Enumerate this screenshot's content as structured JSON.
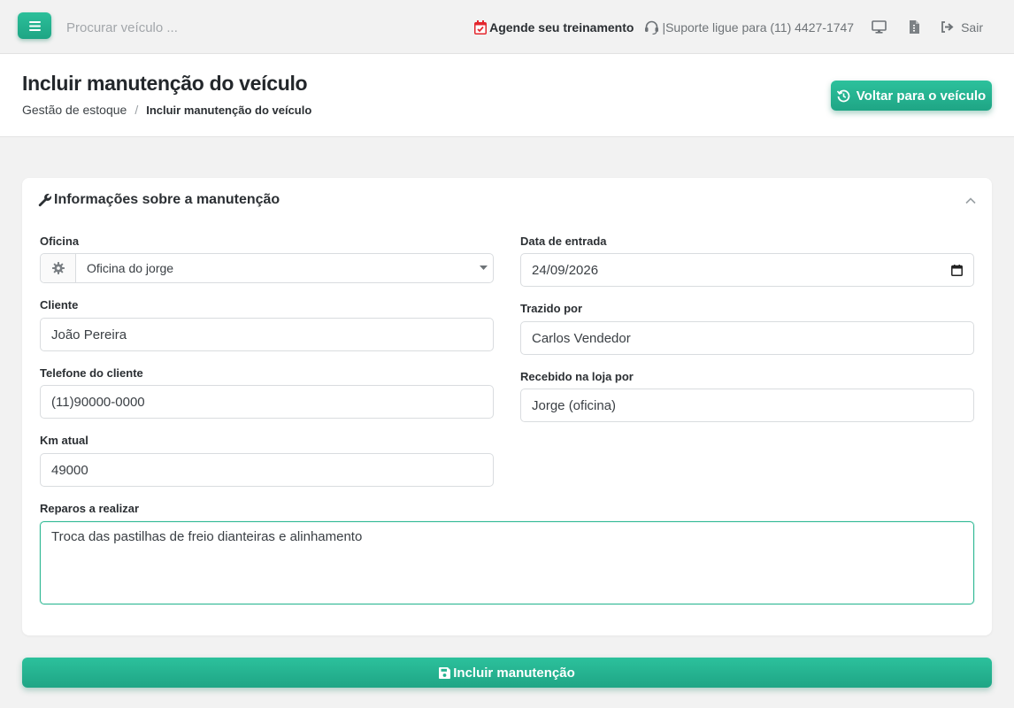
{
  "topbar": {
    "menu_icon": "hamburger-icon",
    "search_placeholder": "Procurar veículo ...",
    "training_label": "Agende seu treinamento",
    "training_icon": "calendar-check-icon",
    "support_label": "|Suporte ligue para (11) 4427-1747",
    "support_icon": "headset-icon",
    "monitor_icon": "monitor-icon",
    "file_icon": "file-icon",
    "logout_label": "Sair",
    "logout_icon": "sign-out-icon"
  },
  "header": {
    "title": "Incluir manutenção do veículo",
    "breadcrumb": [
      "Gestão de estoque",
      "Incluir manutenção do veículo"
    ],
    "breadcrumb_separator": "/",
    "back_button_label": "Voltar para o veículo",
    "back_icon": "history-icon"
  },
  "card": {
    "title": "Informações sobre a manutenção",
    "title_icon": "wrench-icon",
    "collapse_icon": "chevron-up-icon",
    "fields": {
      "oficina": {
        "label": "Oficina",
        "value": "Oficina do jorge",
        "addon_icon": "gear-icon"
      },
      "cliente": {
        "label": "Cliente",
        "value": "João Pereira"
      },
      "telefone": {
        "label": "Telefone do cliente",
        "value": "(11)90000-0000"
      },
      "km": {
        "label": "Km atual",
        "value": "49000"
      },
      "data_entrada": {
        "label": "Data de entrada",
        "value": "24/09/2026"
      },
      "trazido_por": {
        "label": "Trazido por",
        "value": "Carlos Vendedor"
      },
      "recebido_por": {
        "label": "Recebido na loja por",
        "value": "Jorge (oficina)"
      },
      "reparos": {
        "label": "Reparos a realizar",
        "value": "Troca das pastilhas de freio dianteiras e alinhamento"
      }
    }
  },
  "submit": {
    "label": "Incluir manutenção",
    "icon": "save-icon"
  },
  "colors": {
    "accent": "#22b28f",
    "background": "#f2f2f2",
    "calendar_red": "#e3262d"
  }
}
